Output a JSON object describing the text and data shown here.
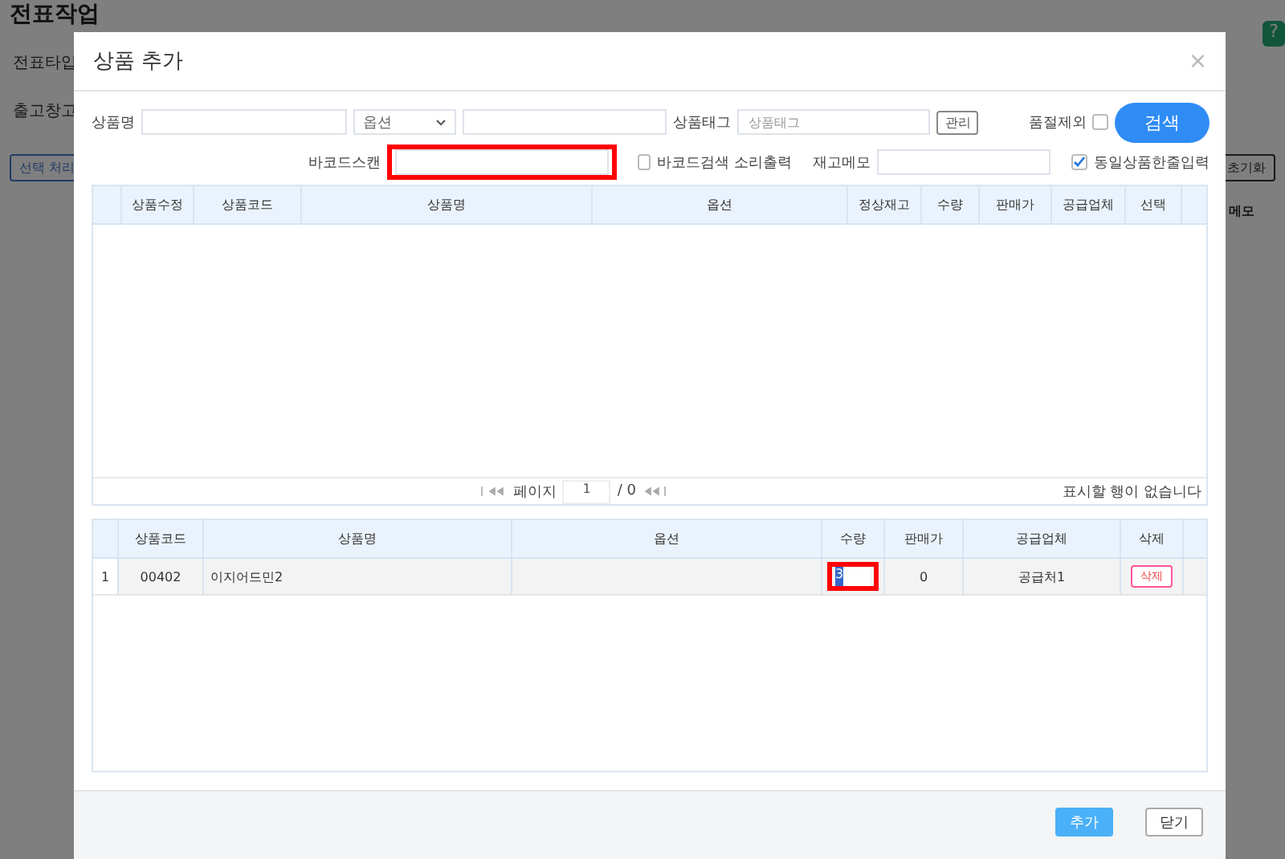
{
  "background": {
    "title": "전표작업",
    "labels": [
      "전표타입",
      "출고창고"
    ],
    "select_button": "선택 처리",
    "reset_button": "초기화",
    "memo_column": "메모",
    "help_button": "?"
  },
  "dialog": {
    "title": "상품 추가",
    "close": "×",
    "search": {
      "name_label": "상품명",
      "option_select": "옵션",
      "tag_label": "상품태그",
      "tag_placeholder": "상품태그",
      "manage_button": "관리",
      "soldout_label": "품절제외",
      "soldout_checked": false,
      "search_button": "검색",
      "barcode_label": "바코드스캔",
      "barcode_highlighted": true,
      "sound_label": "바코드검색 소리출력",
      "sound_checked": false,
      "memo_label": "재고메모",
      "oneline_label": "동일상품한줄입력",
      "oneline_checked": true
    },
    "results": {
      "columns": [
        "상품수정",
        "상품코드",
        "상품명",
        "옵션",
        "정상재고",
        "수량",
        "판매가",
        "공급업체",
        "선택"
      ],
      "pager": {
        "page_label": "페이지",
        "page": "1",
        "total": "/ 0",
        "empty_message": "표시할 행이 없습니다"
      }
    },
    "selected": {
      "columns": [
        "상품코드",
        "상품명",
        "옵션",
        "수량",
        "판매가",
        "공급업체",
        "삭제"
      ],
      "rows": [
        {
          "index": "1",
          "code": "00402",
          "name": "이지어드민2",
          "option": "",
          "quantity": "3",
          "quantity_highlighted": true,
          "price": "0",
          "supplier": "공급처1",
          "delete": "삭제"
        }
      ]
    },
    "buttons": [
      "추가",
      "닫기"
    ]
  }
}
